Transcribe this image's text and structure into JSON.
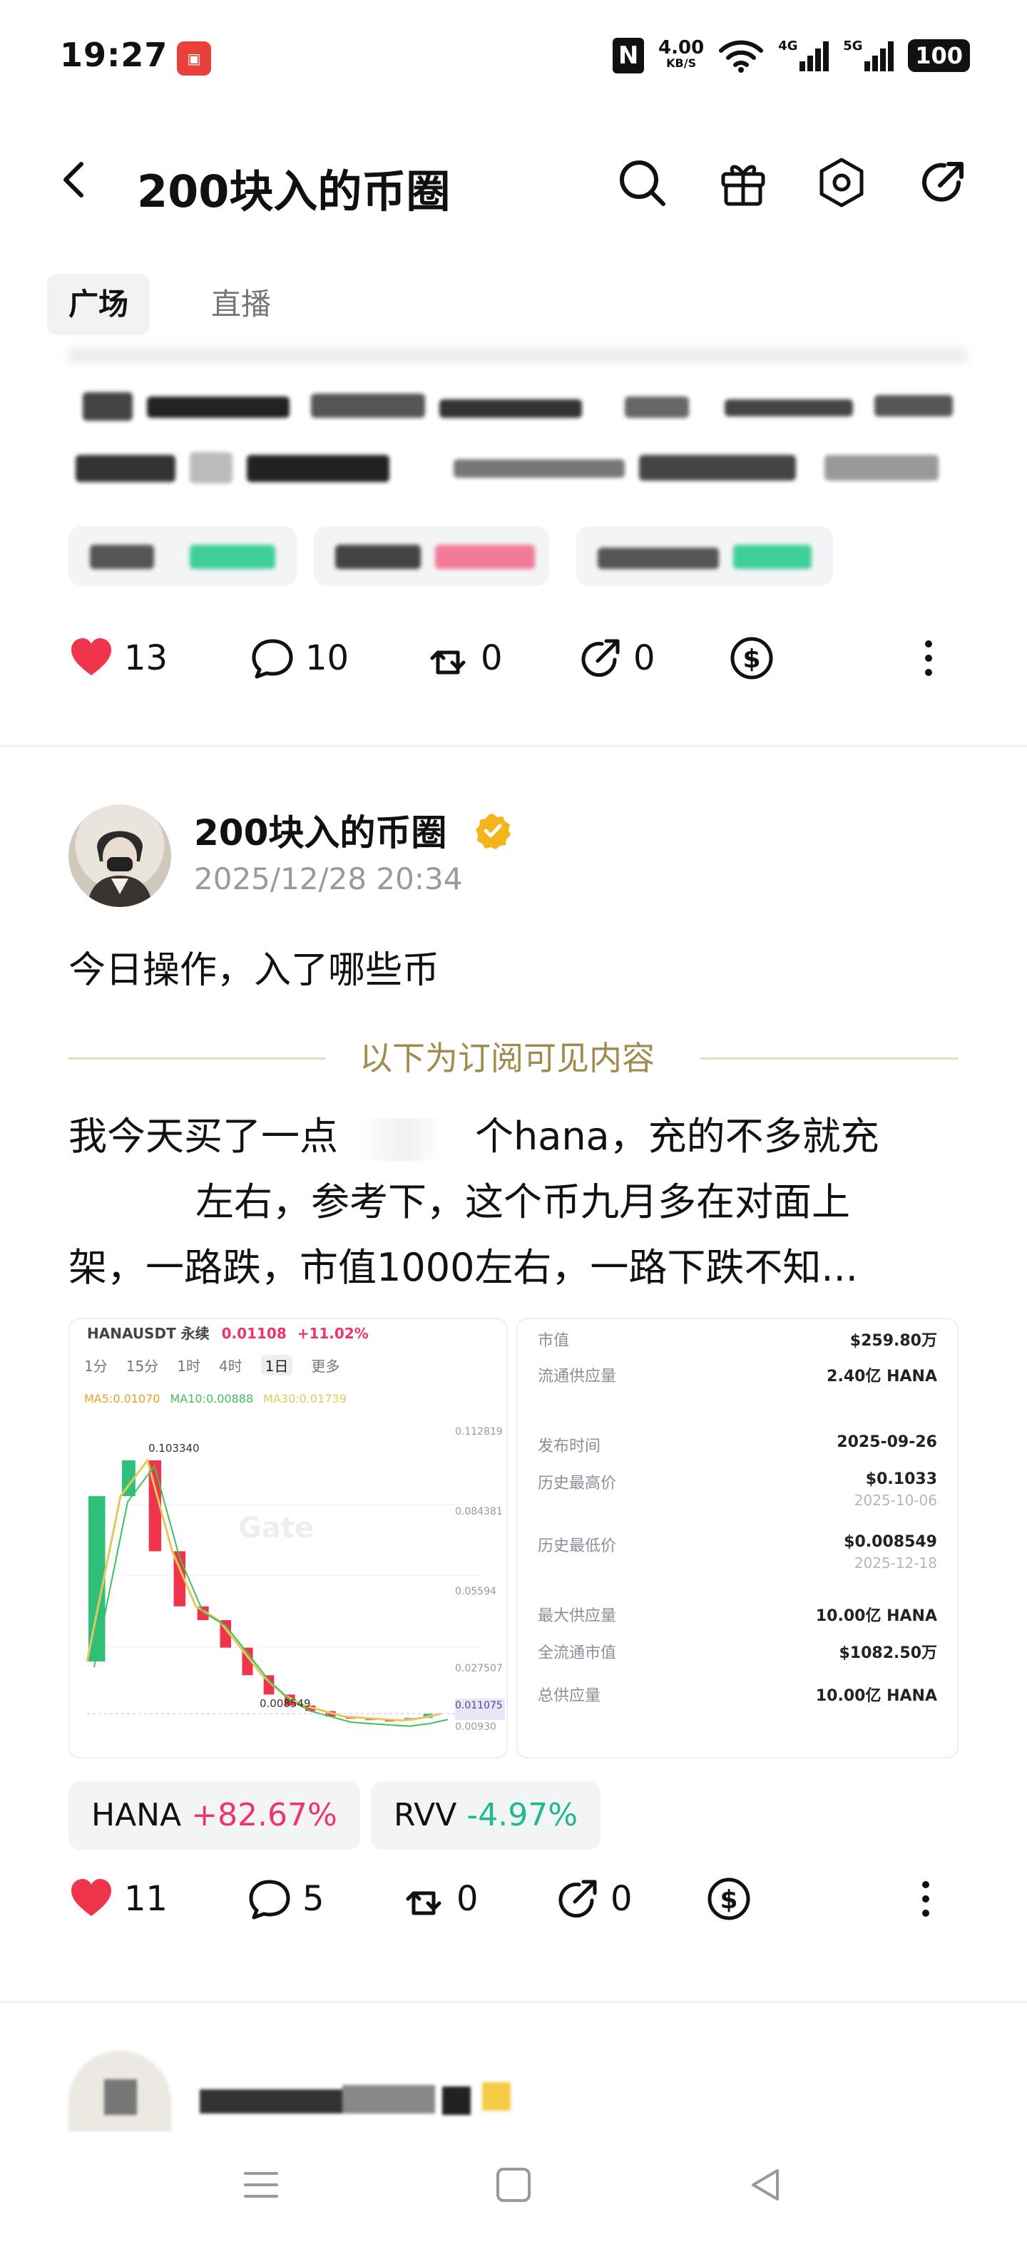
{
  "status_bar": {
    "time": "19:27",
    "app_icon": "app-notification-icon",
    "nfc": "N",
    "speed_value": "4.00",
    "speed_unit": "KB/S",
    "net1": "4G",
    "net2": "5G",
    "battery": "100"
  },
  "header": {
    "title": "200块入的币圈",
    "icons": [
      "back-icon",
      "search-icon",
      "gift-icon",
      "settings-icon",
      "share-icon"
    ]
  },
  "tabs": [
    {
      "label": "广场",
      "active": true
    },
    {
      "label": "直播",
      "active": false
    }
  ],
  "post1": {
    "likes": "13",
    "comments": "10",
    "reposts": "0",
    "shares": "0"
  },
  "post2": {
    "author": "200块入的币圈",
    "date": "2025/12/28 20:34",
    "title": "今日操作，入了哪些币",
    "subscriber_notice": "以下为订阅可见内容",
    "body_line1": "我今天买了一点",
    "body_line1b": "个hana，充的不多就充",
    "body_line2": "左右，参考下，这个币九月多在对面上",
    "body_line3": "架，一路跌，市值1000左右，一路下跌不知...",
    "chart_panel": {
      "symbol": "HANAUSDT 永续",
      "price": "0.01108",
      "change": "+11.02%",
      "intervals": [
        "1分",
        "15分",
        "1时",
        "4时",
        "1日",
        "更多"
      ],
      "active_interval": "1日",
      "ma_labels": [
        "MA5:0.01070",
        "MA10:0.00888",
        "MA30:0.01739"
      ],
      "high_label": "0.103340",
      "low_label": "0.008549",
      "price_axis": [
        "0.112819",
        "0.084381",
        "0.05594",
        "0.027507",
        "0.011075",
        "0.00930"
      ],
      "watermark": "Gate"
    },
    "stats": [
      {
        "k": "市值",
        "v": "$259.80万"
      },
      {
        "k": "流通供应量",
        "v": "2.40亿 HANA"
      },
      {
        "k": "发布时间",
        "v": "2025-09-26"
      },
      {
        "k": "历史最高价",
        "v": "$0.1033",
        "sub": "2025-10-06"
      },
      {
        "k": "历史最低价",
        "v": "$0.008549",
        "sub": "2025-12-18"
      },
      {
        "k": "最大供应量",
        "v": "10.00亿 HANA"
      },
      {
        "k": "全流通市值",
        "v": "$1082.50万"
      },
      {
        "k": "总供应量",
        "v": "10.00亿 HANA"
      }
    ],
    "tags": [
      {
        "name": "HANA",
        "change": "+82.67%"
      },
      {
        "name": "RVV",
        "change": "-4.97%"
      }
    ],
    "likes": "11",
    "comments": "5",
    "reposts": "0",
    "shares": "0"
  },
  "colors": {
    "like_red": "#f0344b",
    "positive": "#f0346b",
    "negative": "#1fba8b",
    "gold": "#a08a4e",
    "verified": "#f3b51b"
  },
  "navbar": [
    "menu-icon",
    "home-square-icon",
    "back-triangle-icon"
  ],
  "chart_data": {
    "type": "line",
    "title": "HANAUSDT 永续",
    "series": [
      {
        "values": [
          0.03,
          0.09,
          0.103,
          0.07,
          0.05,
          0.045,
          0.035,
          0.025,
          0.018,
          0.014,
          0.012,
          0.01,
          0.0095,
          0.009,
          0.0086,
          0.0095,
          0.011
        ]
      }
    ],
    "annotations": [
      "0.103340",
      "0.008549"
    ],
    "ylim": [
      0.0093,
      0.112819
    ],
    "yticks": [
      "0.112819",
      "0.084381",
      "0.05594",
      "0.027507",
      "0.011075",
      "0.00930"
    ]
  }
}
